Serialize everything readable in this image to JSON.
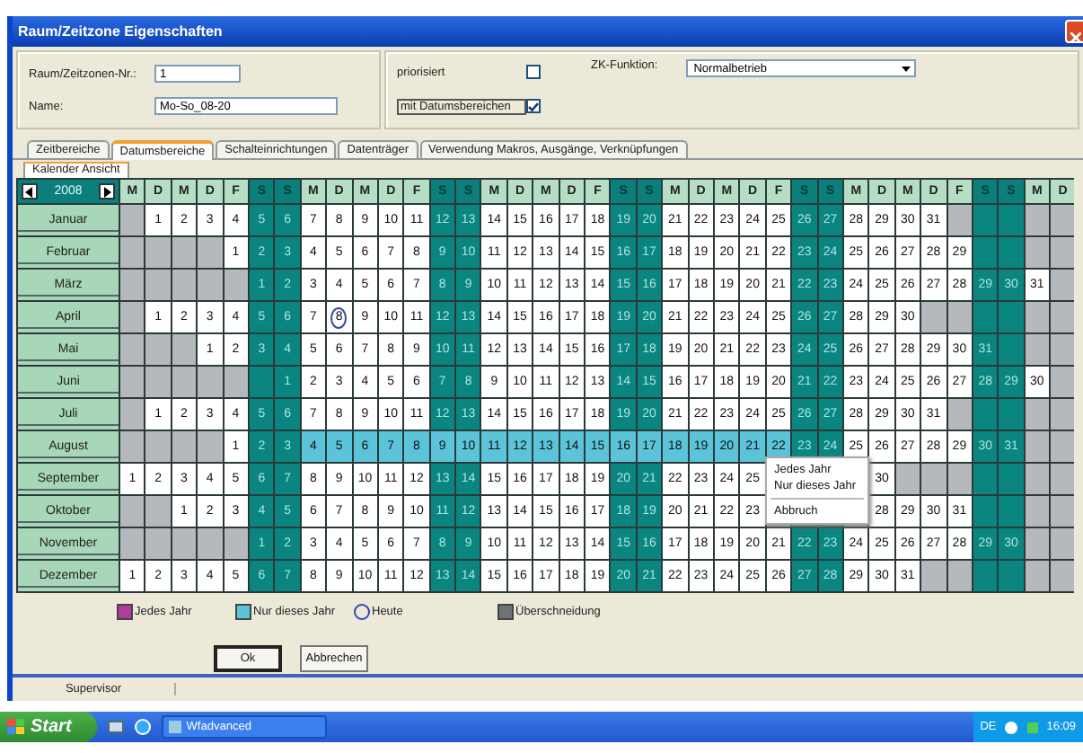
{
  "window": {
    "title": "Raum/Zeitzone Eigenschaften"
  },
  "form": {
    "number": {
      "label": "Raum/Zeitzonen-Nr.:",
      "value": "1"
    },
    "name": {
      "label": "Name:",
      "value": "Mo-So_08-20"
    },
    "prioritized": {
      "label": "priorisiert",
      "checked": false
    },
    "date_ranges": {
      "label": "mit Datumsbereichen",
      "checked": true
    },
    "function": {
      "label": "ZK-Funktion:",
      "value": "Normalbetrieb"
    }
  },
  "tabs": [
    {
      "label": "Zeitbereiche",
      "selected": false
    },
    {
      "label": "Datumsbereiche",
      "selected": true
    },
    {
      "label": "Schalteinrichtungen",
      "selected": false
    },
    {
      "label": "Datenträger",
      "selected": false
    },
    {
      "label": "Verwendung Makros, Ausgänge, Verknüpfungen",
      "selected": false
    }
  ],
  "subtabs": [
    {
      "label": "Kalender Ansicht",
      "selected": true
    }
  ],
  "calendar": {
    "year": "2008",
    "weekdays": [
      {
        "label": "M",
        "weekend": false
      },
      {
        "label": "D",
        "weekend": false
      },
      {
        "label": "M",
        "weekend": false
      },
      {
        "label": "D",
        "weekend": false
      },
      {
        "label": "F",
        "weekend": false
      },
      {
        "label": "S",
        "weekend": true
      },
      {
        "label": "S",
        "weekend": true
      },
      {
        "label": "M",
        "weekend": false
      },
      {
        "label": "D",
        "weekend": false
      },
      {
        "label": "M",
        "weekend": false
      },
      {
        "label": "D",
        "weekend": false
      },
      {
        "label": "F",
        "weekend": false
      },
      {
        "label": "S",
        "weekend": true
      },
      {
        "label": "S",
        "weekend": true
      },
      {
        "label": "M",
        "weekend": false
      },
      {
        "label": "D",
        "weekend": false
      },
      {
        "label": "M",
        "weekend": false
      },
      {
        "label": "D",
        "weekend": false
      },
      {
        "label": "F",
        "weekend": false
      },
      {
        "label": "S",
        "weekend": true
      },
      {
        "label": "S",
        "weekend": true
      },
      {
        "label": "M",
        "weekend": false
      },
      {
        "label": "D",
        "weekend": false
      },
      {
        "label": "M",
        "weekend": false
      },
      {
        "label": "D",
        "weekend": false
      },
      {
        "label": "F",
        "weekend": false
      },
      {
        "label": "S",
        "weekend": true
      },
      {
        "label": "S",
        "weekend": true
      },
      {
        "label": "M",
        "weekend": false
      },
      {
        "label": "D",
        "weekend": false
      },
      {
        "label": "M",
        "weekend": false
      },
      {
        "label": "D",
        "weekend": false
      },
      {
        "label": "F",
        "weekend": false
      },
      {
        "label": "S",
        "weekend": true
      },
      {
        "label": "S",
        "weekend": true
      },
      {
        "label": "M",
        "weekend": false
      },
      {
        "label": "D",
        "weekend": false
      }
    ],
    "months": [
      {
        "name": "Januar",
        "cells": [
          null,
          "1",
          "2",
          "3",
          "4",
          "5",
          "6",
          "7",
          "8",
          "9",
          "10",
          "11",
          "12",
          "13",
          "14",
          "15",
          "16",
          "17",
          "18",
          "19",
          "20",
          "21",
          "22",
          "23",
          "24",
          "25",
          "26",
          "27",
          "28",
          "29",
          "30",
          "31",
          null,
          null,
          null,
          null,
          null
        ]
      },
      {
        "name": "Februar",
        "cells": [
          null,
          null,
          null,
          null,
          "1",
          "2",
          "3",
          "4",
          "5",
          "6",
          "7",
          "8",
          "9",
          "10",
          "11",
          "12",
          "13",
          "14",
          "15",
          "16",
          "17",
          "18",
          "19",
          "20",
          "21",
          "22",
          "23",
          "24",
          "25",
          "26",
          "27",
          "28",
          "29",
          null,
          null,
          null,
          null
        ]
      },
      {
        "name": "März",
        "cells": [
          null,
          null,
          null,
          null,
          null,
          "1",
          "2",
          "3",
          "4",
          "5",
          "6",
          "7",
          "8",
          "9",
          "10",
          "11",
          "12",
          "13",
          "14",
          "15",
          "16",
          "17",
          "18",
          "19",
          "20",
          "21",
          "22",
          "23",
          "24",
          "25",
          "26",
          "27",
          "28",
          "29",
          "30",
          "31",
          null
        ]
      },
      {
        "name": "April",
        "cells": [
          null,
          "1",
          "2",
          "3",
          "4",
          "5",
          "6",
          "7",
          {
            "day": "8",
            "kind": "today"
          },
          "9",
          "10",
          "11",
          "12",
          "13",
          "14",
          "15",
          "16",
          "17",
          "18",
          "19",
          "20",
          "21",
          "22",
          "23",
          "24",
          "25",
          "26",
          "27",
          "28",
          "29",
          "30",
          null,
          null,
          null,
          null,
          null,
          null
        ]
      },
      {
        "name": "Mai",
        "cells": [
          null,
          null,
          null,
          "1",
          "2",
          "3",
          "4",
          "5",
          "6",
          "7",
          "8",
          "9",
          "10",
          "11",
          "12",
          "13",
          "14",
          "15",
          "16",
          "17",
          "18",
          "19",
          "20",
          "21",
          "22",
          "23",
          "24",
          "25",
          "26",
          "27",
          "28",
          "29",
          "30",
          "31",
          null,
          null,
          null
        ]
      },
      {
        "name": "Juni",
        "cells": [
          null,
          null,
          null,
          null,
          null,
          null,
          "1",
          "2",
          "3",
          "4",
          "5",
          "6",
          "7",
          "8",
          "9",
          "10",
          "11",
          "12",
          "13",
          "14",
          "15",
          "16",
          "17",
          "18",
          "19",
          "20",
          "21",
          "22",
          "23",
          "24",
          "25",
          "26",
          "27",
          "28",
          "29",
          "30",
          null
        ]
      },
      {
        "name": "Juli",
        "cells": [
          null,
          "1",
          "2",
          "3",
          "4",
          "5",
          "6",
          "7",
          "8",
          "9",
          "10",
          "11",
          "12",
          "13",
          "14",
          "15",
          "16",
          "17",
          "18",
          "19",
          "20",
          "21",
          "22",
          "23",
          "24",
          "25",
          "26",
          "27",
          "28",
          "29",
          "30",
          "31",
          null,
          null,
          null,
          null,
          null
        ]
      },
      {
        "name": "August",
        "cells": [
          null,
          null,
          null,
          null,
          "1",
          "2",
          "3",
          {
            "day": "4",
            "kind": "once"
          },
          {
            "day": "5",
            "kind": "once"
          },
          {
            "day": "6",
            "kind": "once"
          },
          {
            "day": "7",
            "kind": "once"
          },
          {
            "day": "8",
            "kind": "once"
          },
          {
            "day": "9",
            "kind": "once"
          },
          {
            "day": "10",
            "kind": "once"
          },
          {
            "day": "11",
            "kind": "once"
          },
          {
            "day": "12",
            "kind": "once"
          },
          {
            "day": "13",
            "kind": "once"
          },
          {
            "day": "14",
            "kind": "once"
          },
          {
            "day": "15",
            "kind": "once"
          },
          {
            "day": "16",
            "kind": "once"
          },
          {
            "day": "17",
            "kind": "once"
          },
          {
            "day": "18",
            "kind": "once"
          },
          {
            "day": "19",
            "kind": "once"
          },
          {
            "day": "20",
            "kind": "once"
          },
          {
            "day": "21",
            "kind": "once"
          },
          {
            "day": "22",
            "kind": "once"
          },
          "23",
          "24",
          "25",
          "26",
          "27",
          "28",
          "29",
          "30",
          "31",
          null,
          null
        ]
      },
      {
        "name": "September",
        "cells": [
          "1",
          "2",
          "3",
          "4",
          "5",
          "6",
          "7",
          "8",
          "9",
          "10",
          "11",
          "12",
          "13",
          "14",
          "15",
          "16",
          "17",
          "18",
          "19",
          "20",
          "21",
          "22",
          "23",
          "24",
          "25",
          null,
          null,
          null,
          null,
          "30",
          null,
          null,
          null,
          null,
          null,
          null,
          null
        ]
      },
      {
        "name": "Oktober",
        "cells": [
          null,
          null,
          "1",
          "2",
          "3",
          "4",
          "5",
          "6",
          "7",
          "8",
          "9",
          "10",
          "11",
          "12",
          "13",
          "14",
          "15",
          "16",
          "17",
          "18",
          "19",
          "20",
          "21",
          "22",
          "23",
          null,
          null,
          null,
          null,
          "28",
          "29",
          "30",
          "31",
          null,
          null,
          null,
          null
        ]
      },
      {
        "name": "November",
        "cells": [
          null,
          null,
          null,
          null,
          null,
          "1",
          "2",
          "3",
          "4",
          "5",
          "6",
          "7",
          "8",
          "9",
          "10",
          "11",
          "12",
          "13",
          "14",
          "15",
          "16",
          "17",
          "18",
          "19",
          "20",
          "21",
          "22",
          "23",
          "24",
          "25",
          "26",
          "27",
          "28",
          "29",
          "30",
          null,
          null
        ]
      },
      {
        "name": "Dezember",
        "cells": [
          "1",
          "2",
          "3",
          "4",
          "5",
          "6",
          "7",
          "8",
          "9",
          "10",
          "11",
          "12",
          "13",
          "14",
          "15",
          "16",
          "17",
          "18",
          "19",
          "20",
          "21",
          "22",
          "23",
          "24",
          "25",
          "26",
          "27",
          "28",
          "29",
          "30",
          "31",
          null,
          null,
          null,
          null,
          null,
          null
        ]
      }
    ]
  },
  "context_menu": [
    {
      "kind": "item",
      "label": "Jedes Jahr"
    },
    {
      "kind": "item",
      "label": "Nur dieses Jahr"
    },
    {
      "kind": "separator"
    },
    {
      "kind": "item",
      "label": "Abbruch"
    }
  ],
  "legend": [
    {
      "kind": "yearly",
      "label": "Jedes Jahr",
      "color": "#b03c9c"
    },
    {
      "kind": "once",
      "label": "Nur dieses Jahr",
      "color": "#5cc4d8"
    },
    {
      "kind": "today",
      "label": "Heute",
      "color": "#3048b0"
    },
    {
      "kind": "overlap",
      "label": "Überschneidung",
      "color": "#6c7476"
    }
  ],
  "buttons": [
    {
      "label": "Ok",
      "default": true
    },
    {
      "label": "Abbrechen",
      "default": false
    }
  ],
  "status_bar": [
    "Supervisor"
  ],
  "taskbar": {
    "start": "Start",
    "tasks": [
      "Wfadvanced"
    ],
    "language": "DE",
    "time": "16:09"
  }
}
